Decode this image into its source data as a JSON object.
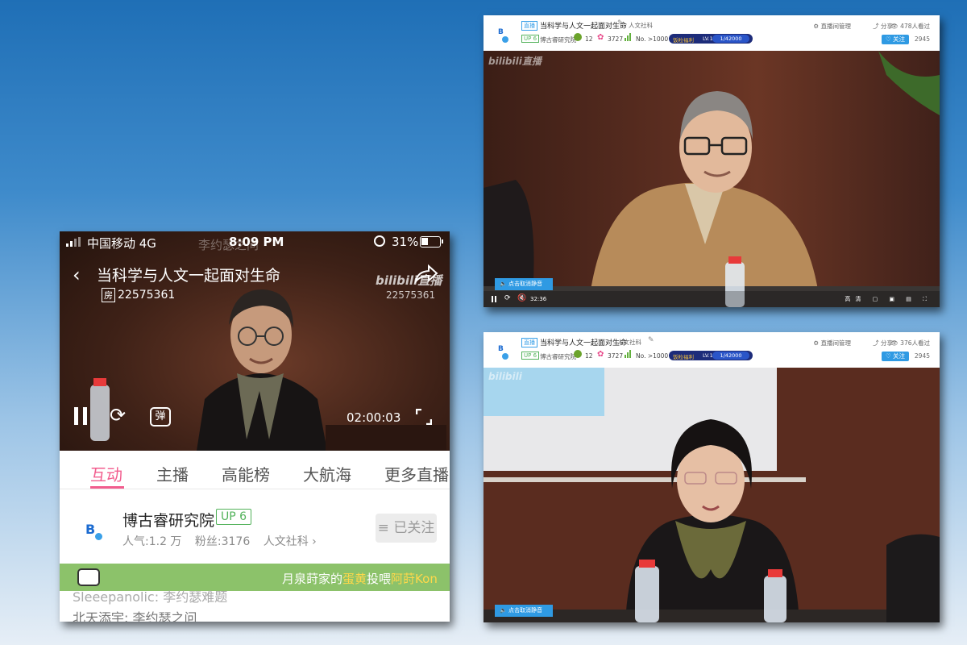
{
  "colors": {
    "accent_pink": "#f25d8e",
    "up_green": "#52b25a",
    "follow_blue": "#2f9ae3",
    "banner_green": "#8cc26a"
  },
  "phone": {
    "status": {
      "carrier": "中国移动 4G",
      "time": "8:09 PM",
      "battery": "31%"
    },
    "title": "当科学与人文一起面对生命",
    "room_label": "房",
    "room_id": "22575361",
    "watermark": "bilibili直播",
    "watermark_id": "22575361",
    "danmu_label": "弹",
    "timer": "02:00:03",
    "tabs": [
      "互动",
      "主播",
      "高能榜",
      "大航海",
      "更多直播"
    ],
    "streamer": {
      "name": "博古睿研究院",
      "level": "UP 6",
      "popularity": "人气:1.2 万",
      "fans": "粉丝:3176",
      "category": "人文社科 ›",
      "follow_label": "≡ 已关注"
    },
    "banner": {
      "text_a": "月泉莳家的",
      "item": "蛋黄",
      "text_b": "投喂",
      "target": "阿莳Kon"
    },
    "chat": [
      "Sleeepanolic: 李约瑟难题",
      "北天添宇: 李约瑟之问"
    ],
    "overlay_text": "李约瑟之问"
  },
  "windows": [
    {
      "live_tag": "直播",
      "title": "当科学与人文一起面对生命",
      "area": "人文社科",
      "up_level": "UP 6",
      "streamer": "博古睿研究院",
      "medal_count": "12",
      "flower_count": "3727",
      "rank": "No. >1000",
      "welfare": "饭粒福利",
      "lv_label": "LV.1:",
      "lv_value": "1/42000",
      "manage": "直播间管理",
      "share": "分享",
      "viewers": "478人看过",
      "follow": "关注",
      "follow_count": "2945",
      "watermark": "bilibili直播",
      "mute_label": "点击取消静音",
      "time": "32:36",
      "quality": "高清"
    },
    {
      "live_tag": "直播",
      "title": "当科学与人文一起面对生命",
      "area": "人文社科",
      "up_level": "UP 6",
      "streamer": "博古睿研究院",
      "medal_count": "12",
      "flower_count": "3727",
      "rank": "No. >1000",
      "welfare": "饭粒福利",
      "lv_label": "LV.1:",
      "lv_value": "1/42000",
      "manage": "直播间管理",
      "share": "分享",
      "viewers": "376人看过",
      "follow": "关注",
      "follow_count": "2945",
      "watermark": "bilibili",
      "mute_label": "点击取消静音"
    }
  ]
}
